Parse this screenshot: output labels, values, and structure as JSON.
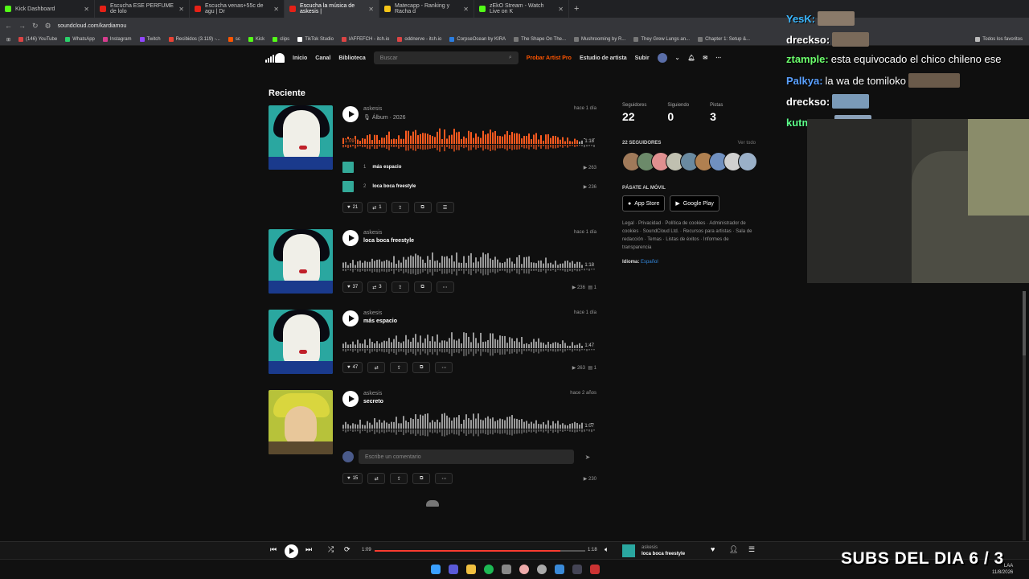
{
  "browser": {
    "tabs": [
      {
        "label": "Kick Dashboard",
        "color": "#53fc18"
      },
      {
        "label": "Escucha ESE PERFUME de lolo",
        "color": "#e62117"
      },
      {
        "label": "Escucha venas+55c de agu | Dr",
        "color": "#e62117"
      },
      {
        "label": "Escucha la música de askesis | ",
        "color": "#e62117"
      },
      {
        "label": "Matecapp - Ranking y Racha d",
        "color": "#f5c518"
      },
      {
        "label": "zEkO Stream - Watch Live on K",
        "color": "#53fc18"
      }
    ],
    "url": "soundcloud.com/kardiamou",
    "bookmarks": [
      "(146) YouTube",
      "WhatsApp",
      "Instagram",
      "Twitch",
      "Recibidos (3.119) -...",
      "sc",
      "Kick",
      "clips",
      "TikTok Studio",
      "IAFFEFCH - itch.io",
      "oddnerve - itch.io",
      "CorpseOcean by KIRA",
      "The Shape On The...",
      "Mushrooming by R...",
      "They Grew Lungs an...",
      "Chapter 1: Setup &..."
    ],
    "bookmarks_right": "Todos los favoritos"
  },
  "soundcloud": {
    "nav": {
      "home": "Inicio",
      "feed": "Canal",
      "library": "Biblioteca",
      "search_placeholder": "Buscar",
      "pro": "Probar Artist Pro",
      "studio": "Estudio de artista",
      "upload": "Subir"
    },
    "section_title": "Reciente",
    "tracks": [
      {
        "artist": "askesis",
        "title": "Álbum · 2026",
        "when": "hace 1 día",
        "elapsed": "1:09",
        "duration": "1:18",
        "progress": 0.93,
        "list": [
          {
            "n": "1",
            "name": "más espacio",
            "plays": "263"
          },
          {
            "n": "2",
            "name": "loca boca freestyle",
            "plays": "236"
          }
        ],
        "likes": "21",
        "reposts": "1"
      },
      {
        "artist": "askesis",
        "title": "loca boca freestyle",
        "when": "hace 1 día",
        "duration": "1:18",
        "likes": "37",
        "reposts": "3",
        "plays": "236",
        "comments": "1"
      },
      {
        "artist": "askesis",
        "title": "más espacio",
        "when": "hace 1 día",
        "duration": "1:47",
        "likes": "47",
        "plays": "263",
        "comments": "1"
      },
      {
        "artist": "askesis",
        "title": "secreto",
        "when": "hace 2 años",
        "duration": "1:07",
        "likes": "15",
        "plays": "230"
      }
    ],
    "comment_placeholder": "Escribe un comentario",
    "sidebar": {
      "followers_label": "Seguidores",
      "followers": "22",
      "following_label": "Siguiendo",
      "following": "0",
      "tracks_label": "Pistas",
      "tracks": "3",
      "followers_heading": "22 SEGUIDORES",
      "view_all": "Ver todo",
      "mobile_heading": "PÁSATE AL MÓVIL",
      "app_store": "App Store",
      "google_play": "Google Play",
      "legal": "Legal · Privacidad · Política de cookies · Administrador de cookies · SoundCloud Ltd. · Recursos para artistas · Sala de redacción · Temas · Listas de éxitos · Informes de transparencia",
      "language_label": "Idioma:",
      "language": "Español"
    },
    "player": {
      "elapsed": "1:09",
      "duration": "1:18",
      "progress": 0.88,
      "artist": "askesis",
      "title": "loca boca freestyle"
    }
  },
  "chat": [
    {
      "user": "YesK:",
      "color": "#3ab7ff",
      "text": ""
    },
    {
      "user": "dreckso:",
      "color": "#ffffff",
      "text": ""
    },
    {
      "user": "ztample:",
      "color": "#6cff6c",
      "text": "esta equivocado el chico chileno ese"
    },
    {
      "user": "Palkya:",
      "color": "#5aa0ff",
      "text": "la wa de tomiloko"
    },
    {
      "user": "dreckso:",
      "color": "#ffffff",
      "text": ""
    },
    {
      "user": "kutma04:",
      "color": "#5cff8a",
      "text": ""
    }
  ],
  "overlay": {
    "subs": "SUBS DEL DIA 6 / 3"
  },
  "clock": {
    "time": "LAA",
    "date": "11/8/2026"
  }
}
